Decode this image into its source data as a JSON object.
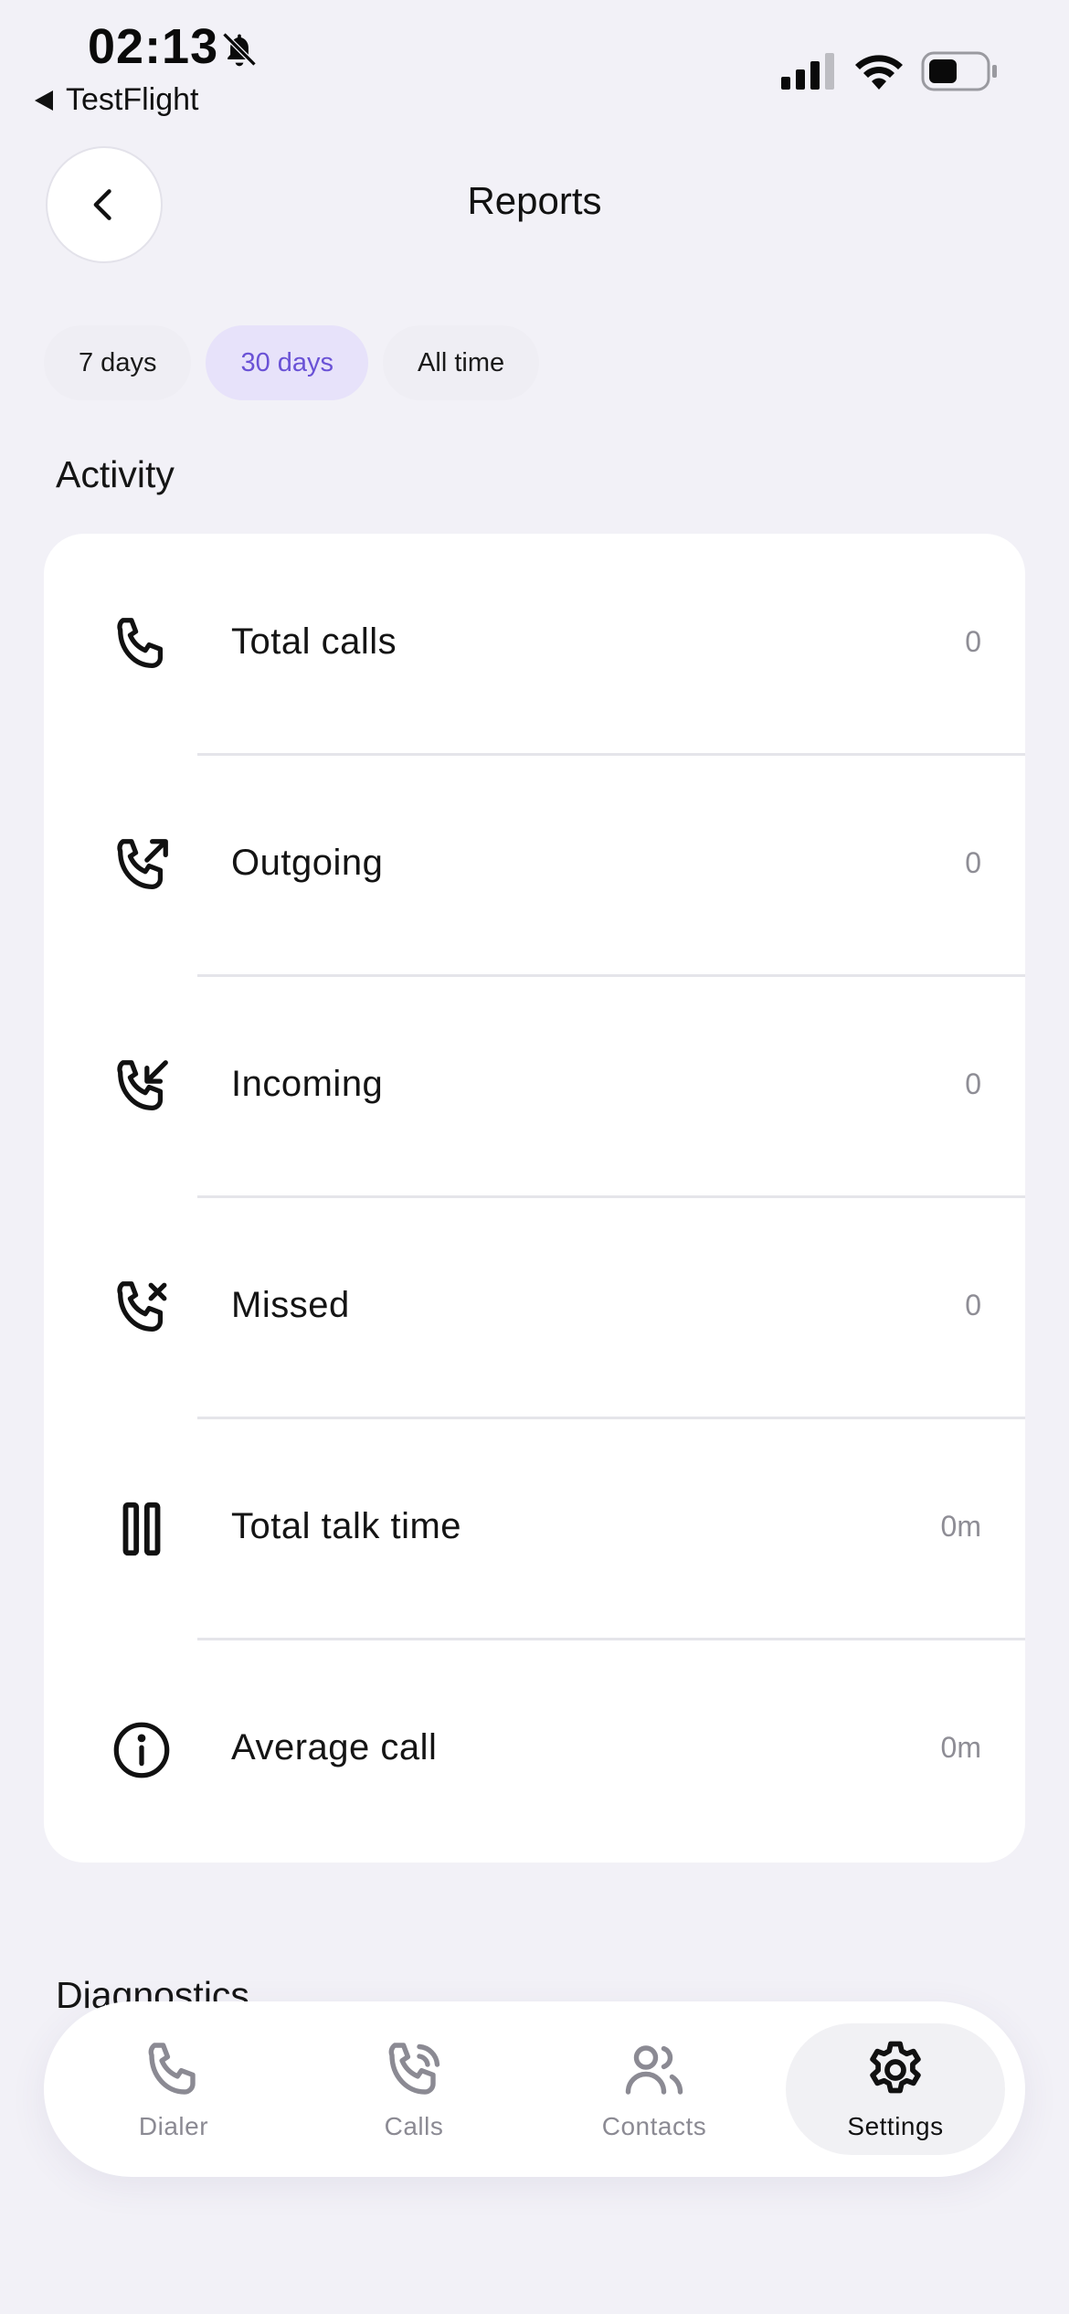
{
  "status_bar": {
    "time": "02:13",
    "back_app": "TestFlight",
    "icons": [
      "bell-slash-icon",
      "cellular-signal-icon",
      "wifi-icon",
      "battery-icon"
    ]
  },
  "header": {
    "title": "Reports",
    "back_icon": "chevron-left-icon"
  },
  "range_tabs": [
    {
      "label": "7 days",
      "selected": false
    },
    {
      "label": "30 days",
      "selected": true
    },
    {
      "label": "All time",
      "selected": false
    }
  ],
  "activity": {
    "title": "Activity",
    "rows": [
      {
        "icon": "phone-icon",
        "label": "Total calls",
        "value": "0"
      },
      {
        "icon": "phone-outgoing-icon",
        "label": "Outgoing",
        "value": "0"
      },
      {
        "icon": "phone-incoming-icon",
        "label": "Incoming",
        "value": "0"
      },
      {
        "icon": "phone-missed-icon",
        "label": "Missed",
        "value": "0"
      },
      {
        "icon": "pause-icon",
        "label": "Total talk time",
        "value": "0m"
      },
      {
        "icon": "info-icon",
        "label": "Average call",
        "value": "0m"
      }
    ]
  },
  "next_section_title": "Diagnostics",
  "bottom_nav": {
    "items": [
      {
        "label": "Dialer",
        "icon": "phone-icon",
        "active": false
      },
      {
        "label": "Calls",
        "icon": "phone-ringing-icon",
        "active": false
      },
      {
        "label": "Contacts",
        "icon": "users-icon",
        "active": false
      },
      {
        "label": "Settings",
        "icon": "gear-icon",
        "active": true
      }
    ]
  },
  "colors": {
    "background": "#f2f1f7",
    "accent": "#6a52d6",
    "accent_bg": "#e7e2fa",
    "muted": "#8e8d95"
  }
}
